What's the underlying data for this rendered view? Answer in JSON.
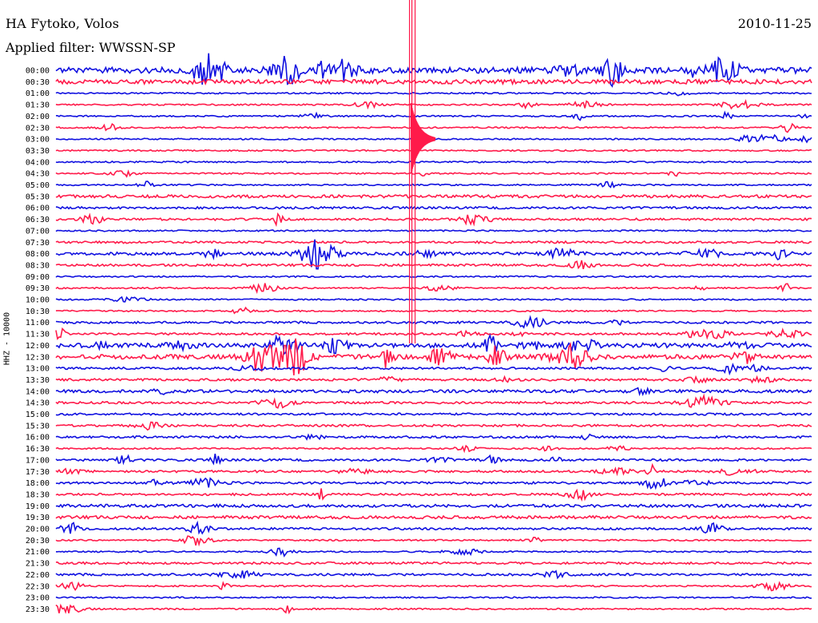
{
  "header": {
    "station": "HA Fytoko, Volos",
    "date": "2010-11-25",
    "filter": "Applied filter: WWSSN-SP"
  },
  "chart_data": {
    "type": "helicorder",
    "title": "HA Fytoko, Volos",
    "date": "2010-11-25",
    "filter": "WWSSN-SP",
    "ylabel": "HHZ - 10000",
    "trace_colors": [
      "#1010e0",
      "#ff1a4a"
    ],
    "rows": [
      "00:00",
      "00:30",
      "01:00",
      "01:30",
      "02:00",
      "02:30",
      "03:00",
      "03:30",
      "04:00",
      "04:30",
      "05:00",
      "05:30",
      "06:00",
      "06:30",
      "07:00",
      "07:30",
      "08:00",
      "08:30",
      "09:00",
      "09:30",
      "10:00",
      "10:30",
      "11:00",
      "11:30",
      "12:00",
      "12:30",
      "13:00",
      "13:30",
      "14:00",
      "14:30",
      "15:00",
      "15:30",
      "16:00",
      "16:30",
      "17:00",
      "17:30",
      "18:00",
      "18:30",
      "19:00",
      "19:30",
      "20:00",
      "20:30",
      "21:00",
      "21:30",
      "22:00",
      "22:30",
      "23:00",
      "23:30"
    ],
    "noise_levels": [
      4,
      3,
      1,
      1,
      1,
      1,
      1,
      1,
      1,
      1,
      1,
      2,
      1.5,
      1.5,
      1,
      1.5,
      2,
      1.5,
      1,
      1,
      1,
      1,
      1.5,
      1.5,
      3,
      3,
      1.5,
      1.5,
      2,
      1.5,
      1.5,
      1.5,
      1.5,
      1,
      1.5,
      1.5,
      1.5,
      1.5,
      2,
      2,
      1.5,
      1,
      1,
      1.5,
      1.5,
      1,
      1,
      1
    ],
    "main_event": {
      "row": "02:30",
      "time_fraction": 0.47,
      "peak_amplitude": 520
    }
  }
}
